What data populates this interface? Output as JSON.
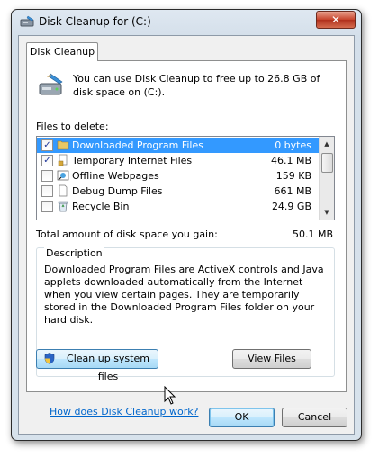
{
  "window": {
    "title": "Disk Cleanup for  (C:)",
    "close_glyph": "✕"
  },
  "tab": {
    "label": "Disk Cleanup"
  },
  "intro": {
    "text": "You can use Disk Cleanup to free up to 26.8 GB of disk space on  (C:).",
    "icon": "disk-cleanup-icon"
  },
  "files_label": "Files to delete:",
  "files": [
    {
      "checked": true,
      "name": "Downloaded Program Files",
      "size": "0 bytes",
      "selected": true,
      "icon": "folder-icon"
    },
    {
      "checked": true,
      "name": "Temporary Internet Files",
      "size": "46.1 MB",
      "selected": false,
      "icon": "document-lock-icon"
    },
    {
      "checked": false,
      "name": "Offline Webpages",
      "size": "159 KB",
      "selected": false,
      "icon": "offline-webpage-icon"
    },
    {
      "checked": false,
      "name": "Debug Dump Files",
      "size": "661 MB",
      "selected": false,
      "icon": "blank-document-icon"
    },
    {
      "checked": false,
      "name": "Recycle Bin",
      "size": "24.9 GB",
      "selected": false,
      "icon": "recycle-bin-icon"
    }
  ],
  "check_glyph": "✓",
  "total": {
    "label": "Total amount of disk space you gain:",
    "value": "50.1 MB"
  },
  "description": {
    "title": "Description",
    "text": "Downloaded Program Files are ActiveX controls and Java applets downloaded automatically from the Internet when you view certain pages. They are temporarily stored in the Downloaded Program Files folder on your hard disk."
  },
  "buttons": {
    "cleanup_system": "Clean up system files",
    "view_files": "View Files",
    "ok": "OK",
    "cancel": "Cancel"
  },
  "help_link": "How does Disk Cleanup work?",
  "colors": {
    "selection": "#3399ff",
    "link": "#0066cc",
    "close_button": "#c7422a"
  }
}
